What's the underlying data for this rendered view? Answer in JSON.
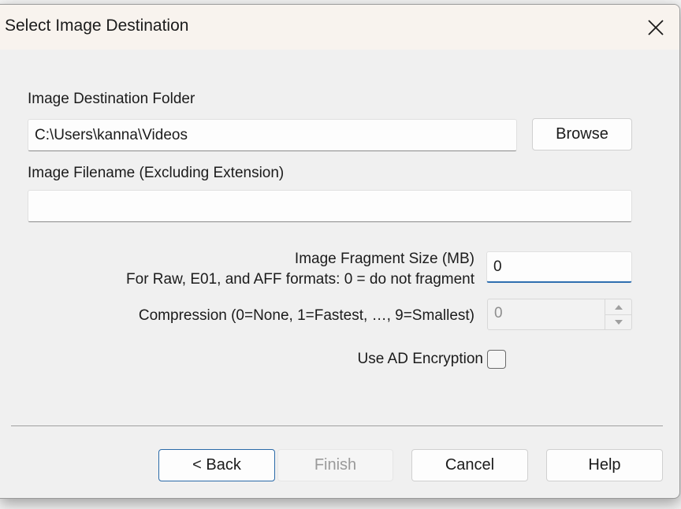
{
  "dialog": {
    "title": "Select Image Destination"
  },
  "folder": {
    "label": "Image Destination Folder",
    "value": "C:\\Users\\kanna\\Videos",
    "browse_label": "Browse"
  },
  "filename": {
    "label": "Image Filename (Excluding Extension)",
    "value": ""
  },
  "fragment": {
    "label_line1": "Image Fragment Size (MB)",
    "label_line2": "For Raw, E01, and AFF formats: 0 = do not fragment",
    "value": "0"
  },
  "compression": {
    "label": "Compression (0=None, 1=Fastest, ..., 9=Smallest)",
    "label_display": "Compression (0=None, 1=Fastest, …, 9=Smallest)",
    "value": "0"
  },
  "encryption": {
    "label": "Use AD Encryption",
    "checked": false
  },
  "buttons": {
    "back": "< Back",
    "finish": "Finish",
    "cancel": "Cancel",
    "help": "Help"
  },
  "icons": {
    "close": "close-icon",
    "spin_up": "chevron-up-icon",
    "spin_down": "chevron-down-icon"
  }
}
